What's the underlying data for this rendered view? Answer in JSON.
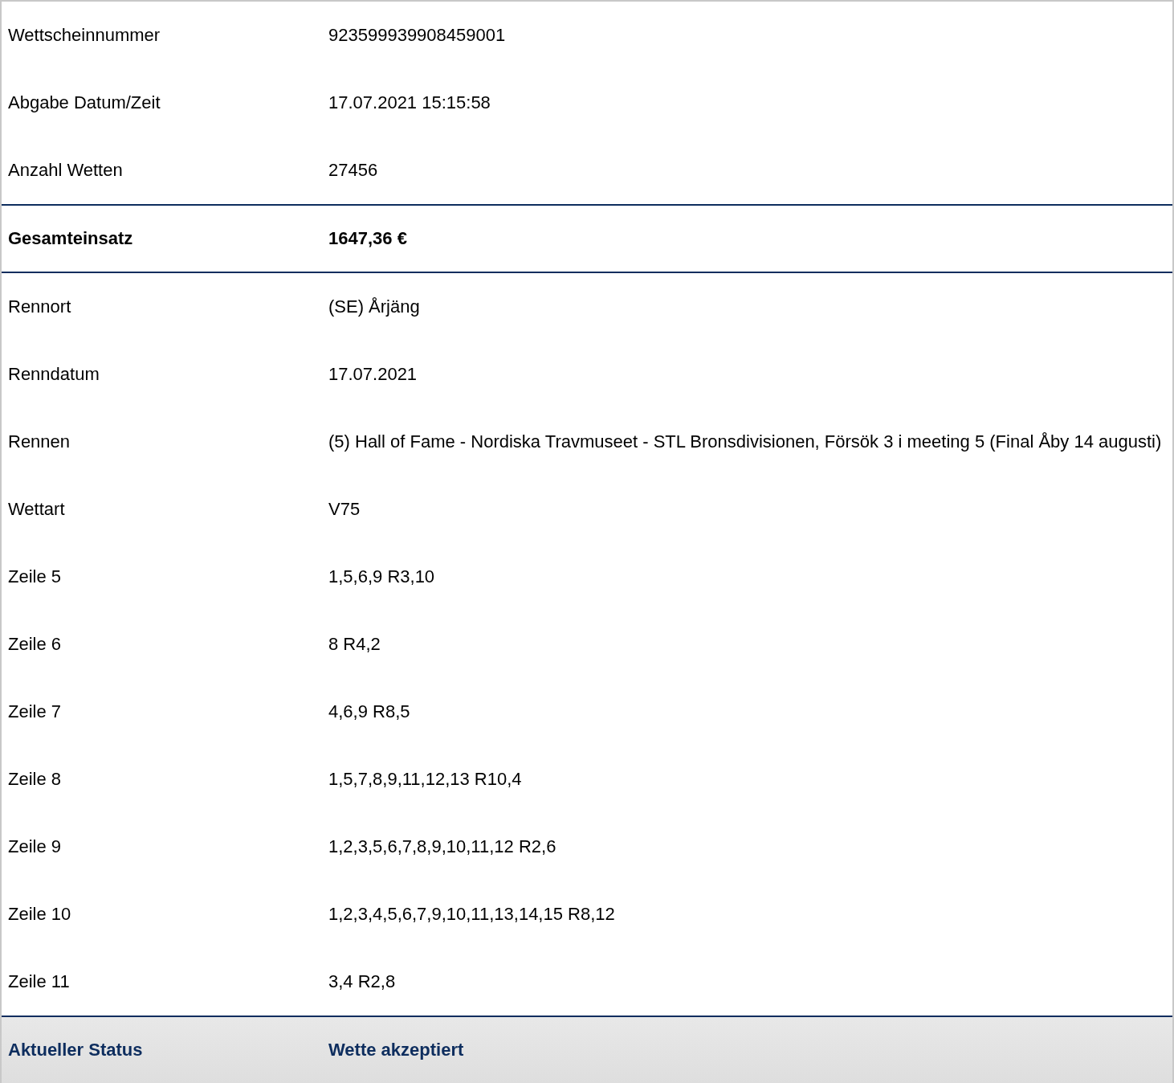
{
  "rows": [
    {
      "kind": "plain",
      "label": "Wettscheinnummer",
      "value": "923599939908459001"
    },
    {
      "kind": "plain",
      "label": "Abgabe Datum/Zeit",
      "value": "17.07.2021 15:15:58"
    },
    {
      "kind": "plain",
      "label": "Anzahl Wetten",
      "value": "27456"
    },
    {
      "kind": "total",
      "label": "Gesamteinsatz",
      "value": "1647,36 €"
    },
    {
      "kind": "plain",
      "label": "Rennort",
      "value": "(SE) Årjäng"
    },
    {
      "kind": "plain",
      "label": "Renndatum",
      "value": "17.07.2021"
    },
    {
      "kind": "plain",
      "label": "Rennen",
      "value": "(5) Hall of Fame - Nordiska Travmuseet - STL Bronsdivisionen, Försök 3 i meeting 5 (Final Åby 14 augusti)"
    },
    {
      "kind": "plain",
      "label": "Wettart",
      "value": "V75"
    },
    {
      "kind": "plain",
      "label": "Zeile 5",
      "value": "1,5,6,9 R3,10"
    },
    {
      "kind": "plain",
      "label": "Zeile 6",
      "value": "8 R4,2"
    },
    {
      "kind": "plain",
      "label": "Zeile 7",
      "value": "4,6,9 R8,5"
    },
    {
      "kind": "plain",
      "label": "Zeile 8",
      "value": "1,5,7,8,9,11,12,13 R10,4"
    },
    {
      "kind": "plain",
      "label": "Zeile 9",
      "value": "1,2,3,5,6,7,8,9,10,11,12 R2,6"
    },
    {
      "kind": "plain",
      "label": "Zeile 10",
      "value": "1,2,3,4,5,6,7,9,10,11,13,14,15 R8,12"
    },
    {
      "kind": "plain",
      "label": "Zeile 11",
      "value": "3,4 R2,8"
    },
    {
      "kind": "status",
      "label": "Aktueller Status",
      "value": "Wette akzeptiert"
    }
  ]
}
